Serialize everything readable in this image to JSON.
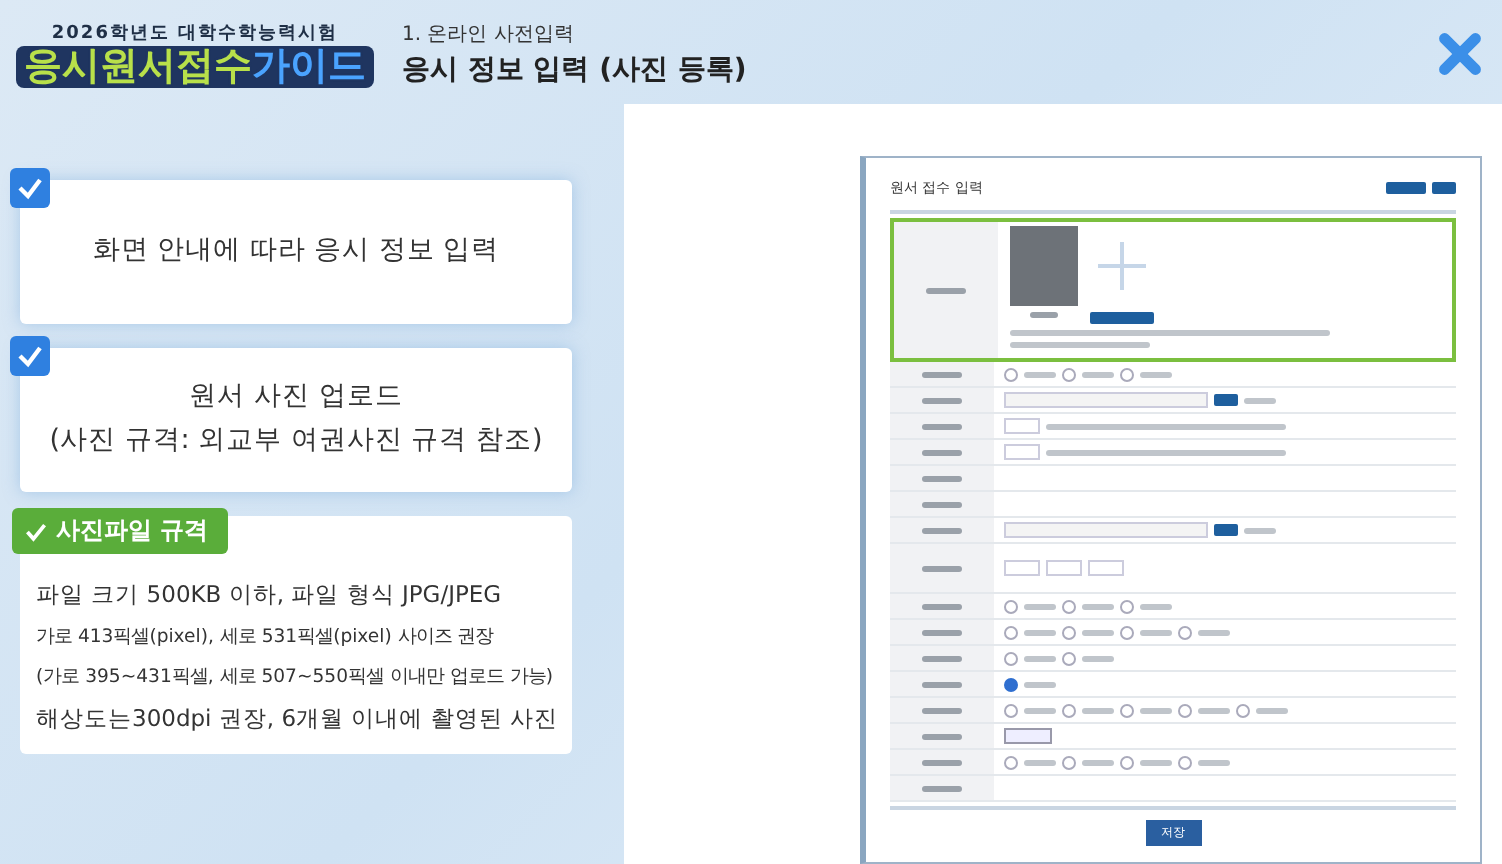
{
  "header": {
    "exam_year": "2026학년도 대학수학능력시험",
    "logo_main": "응시원서접수",
    "logo_accent": "가이드",
    "section": "1. 온라인 사전입력",
    "title": "응시 정보 입력 (사진 등록)"
  },
  "steps": [
    {
      "text": "화면 안내에 따라 응시 정보 입력",
      "checked": true
    },
    {
      "text": "원서 사진 업로드\n(사진 규격: 외교부 여권사진 규격 참조)",
      "checked": true
    }
  ],
  "spec": {
    "tab": "사진파일 규격",
    "lines": [
      "파일 크기 500KB 이하, 파일 형식 JPG/JPEG",
      "가로 413픽셀(pixel), 세로 531픽셀(pixel) 사이즈 권장",
      "(가로 395~431픽셀, 세로 507~550픽셀 이내만 업로드 가능)",
      "해상도는300dpi 권장, 6개월 이내에 촬영된 사진"
    ]
  },
  "form": {
    "title": "원서 접수 입력",
    "save": "저장",
    "rows": [
      {
        "kind": "photo",
        "highlighted": true
      },
      {
        "kind": "radio",
        "options": [
          {
            "selected": false
          },
          {
            "selected": false
          },
          {
            "selected": false
          }
        ]
      },
      {
        "kind": "search"
      },
      {
        "kind": "input"
      },
      {
        "kind": "input"
      },
      {
        "kind": "blank"
      },
      {
        "kind": "blank"
      },
      {
        "kind": "search"
      },
      {
        "kind": "phone"
      },
      {
        "kind": "radio",
        "options": [
          {
            "selected": false
          },
          {
            "selected": false
          },
          {
            "selected": false
          }
        ]
      },
      {
        "kind": "radio",
        "options": [
          {
            "selected": false
          },
          {
            "selected": false
          },
          {
            "selected": false
          },
          {
            "selected": false
          }
        ]
      },
      {
        "kind": "radio",
        "options": [
          {
            "selected": false
          },
          {
            "selected": false
          }
        ]
      },
      {
        "kind": "radio",
        "options": [
          {
            "selected": true
          }
        ]
      },
      {
        "kind": "radio",
        "options": [
          {
            "selected": false
          },
          {
            "selected": false
          },
          {
            "selected": false
          },
          {
            "selected": false
          },
          {
            "selected": false
          }
        ]
      },
      {
        "kind": "select"
      },
      {
        "kind": "radio",
        "options": [
          {
            "selected": false
          },
          {
            "selected": false
          },
          {
            "selected": false
          },
          {
            "selected": false
          }
        ]
      },
      {
        "kind": "blank"
      }
    ]
  }
}
